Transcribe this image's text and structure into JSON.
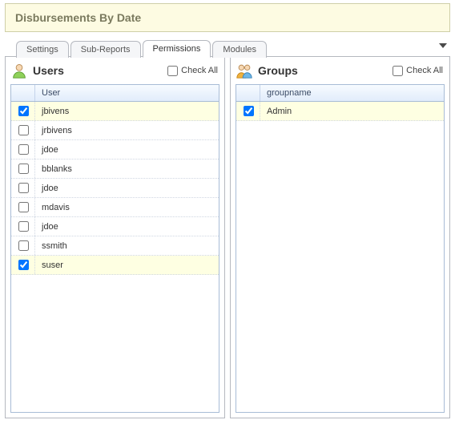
{
  "header": {
    "title": "Disbursements By Date"
  },
  "tabs": {
    "items": [
      {
        "label": "Settings",
        "active": false
      },
      {
        "label": "Sub-Reports",
        "active": false
      },
      {
        "label": "Permissions",
        "active": true
      },
      {
        "label": "Modules",
        "active": false
      }
    ]
  },
  "users_panel": {
    "title": "Users",
    "check_all_label": "Check All",
    "column_header": "User",
    "rows": [
      {
        "name": "jbivens",
        "checked": true
      },
      {
        "name": "jrbivens",
        "checked": false
      },
      {
        "name": "jdoe",
        "checked": false
      },
      {
        "name": "bblanks",
        "checked": false
      },
      {
        "name": "jdoe",
        "checked": false
      },
      {
        "name": "mdavis",
        "checked": false
      },
      {
        "name": "jdoe",
        "checked": false
      },
      {
        "name": "ssmith",
        "checked": false
      },
      {
        "name": "suser",
        "checked": true
      }
    ]
  },
  "groups_panel": {
    "title": "Groups",
    "check_all_label": "Check All",
    "column_header": "groupname",
    "rows": [
      {
        "name": "Admin",
        "checked": true
      }
    ]
  }
}
